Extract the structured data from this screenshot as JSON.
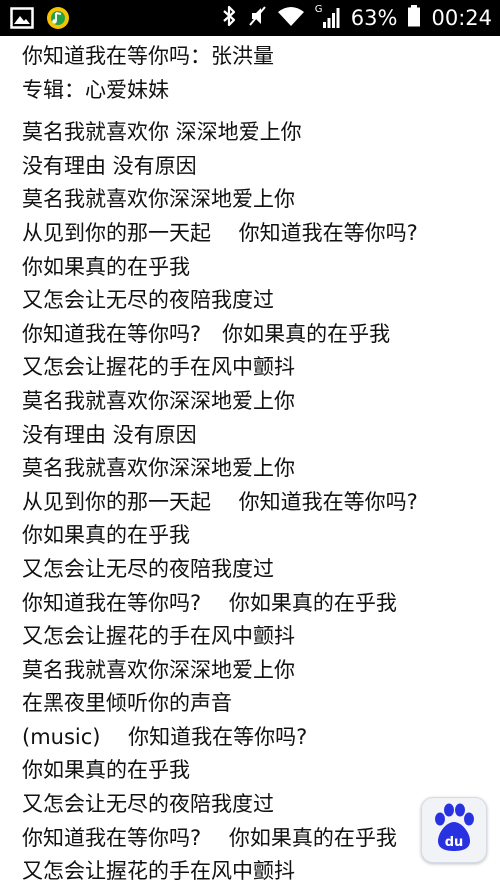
{
  "status_bar": {
    "icons": [
      "gallery-icon",
      "music-app-icon",
      "bluetooth-icon",
      "silent-icon",
      "wifi-icon",
      "signal-icon",
      "battery-icon"
    ],
    "network_type": "G",
    "battery": "63%",
    "time": "00:24"
  },
  "header": {
    "song_line": "你知道我在等你吗：张洪量",
    "album_line": "专辑：心爱妹妹"
  },
  "lyrics": [
    "莫名我就喜欢你 深深地爱上你",
    "没有理由 没有原因",
    "莫名我就喜欢你深深地爱上你",
    "从见到你的那一天起　 你知道我在等你吗?",
    "你如果真的在乎我",
    "又怎会让无尽的夜陪我度过",
    "你知道我在等你吗?　你如果真的在乎我",
    "又怎会让握花的手在风中颤抖",
    "莫名我就喜欢你深深地爱上你",
    "没有理由 没有原因",
    "莫名我就喜欢你深深地爱上你",
    "从见到你的那一天起　 你知道我在等你吗?",
    "你如果真的在乎我",
    "又怎会让无尽的夜陪我度过",
    "你知道我在等你吗?　 你如果真的在乎我",
    "又怎会让握花的手在风中颤抖",
    "莫名我就喜欢你深深地爱上你",
    "在黑夜里倾听你的声音",
    "(music)　 你知道我在等你吗?",
    "你如果真的在乎我",
    "又怎会让无尽的夜陪我度过",
    "你知道我在等你吗?　 你如果真的在乎我",
    "又怎会让握花的手在风中颤抖"
  ],
  "floating_button": {
    "icon": "baidu-paw-icon",
    "label": "du"
  },
  "colors": {
    "status_bar_bg": "#000000",
    "page_bg": "#ffffff",
    "text": "#111111",
    "baidu_blue": "#2932e1"
  }
}
